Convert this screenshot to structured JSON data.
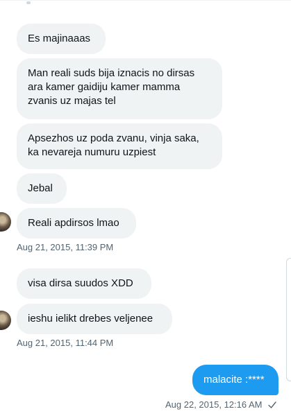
{
  "conversation": {
    "incoming_messages": [
      "Es majinaaas",
      "Man reali suds bija iznacis no dirsas\nara kamer gaidiju kamer mamma\nzvanis uz majas tel",
      "Apsezhos uz poda zvanu, vinja saka,\nka nevareja numuru uzpiest",
      "Jebal",
      "Reali apdirsos lmao",
      "visa dirsa suudos XDD",
      "ieshu ielikt drebes veljenee"
    ],
    "timestamps": [
      "Aug 21, 2015, 11:39 PM",
      "Aug 21, 2015, 11:44 PM"
    ],
    "outgoing_message": "malacite :****",
    "outgoing_timestamp": "Aug 22, 2015, 12:16 AM",
    "read_indicator_icon": "checkmark-icon"
  },
  "colors": {
    "incoming_bubble": "#eff3f4",
    "outgoing_bubble": "#1d9bf0",
    "timestamp_text": "#536471"
  }
}
